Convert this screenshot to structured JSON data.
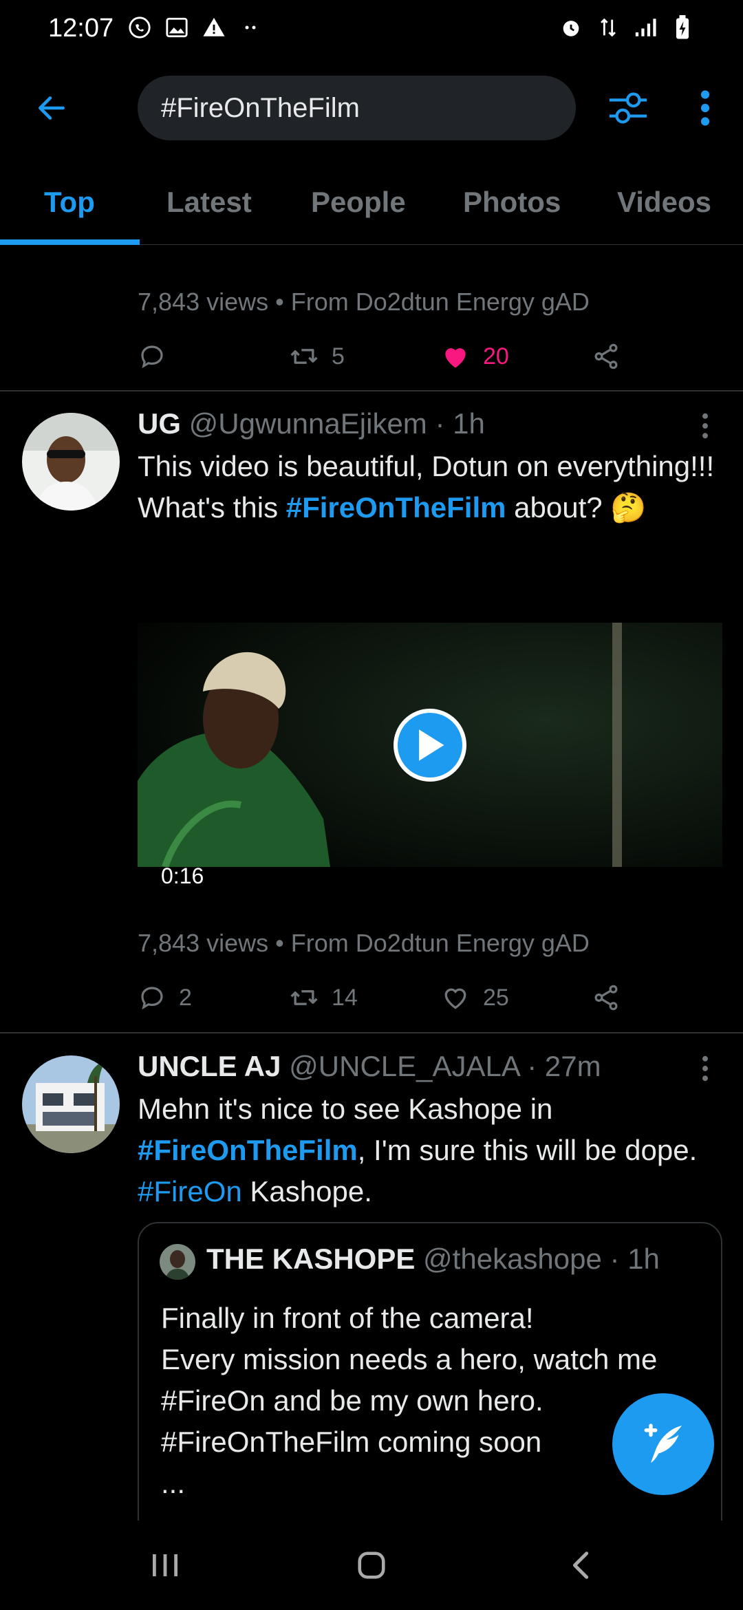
{
  "status_bar": {
    "time": "12:07"
  },
  "search": {
    "query": "#FireOnTheFilm"
  },
  "tabs": [
    {
      "label": "Top",
      "active": true
    },
    {
      "label": "Latest",
      "active": false
    },
    {
      "label": "People",
      "active": false
    },
    {
      "label": "Photos",
      "active": false
    },
    {
      "label": "Videos",
      "active": false
    }
  ],
  "prev_tweet": {
    "views_line": "7,843 views • From Do2dtun Energy gAD",
    "retweets": "5",
    "likes": "20"
  },
  "tweet1": {
    "name": "UG",
    "handle": "@UgwunnaEjikem",
    "time": "· 1h",
    "text_1": "This video is beautiful, Dotun on everything!!! What's this ",
    "hashtag": "#FireOnTheFilm",
    "text_2": " about? 🤔",
    "video_duration": "0:16",
    "views_line": "7,843 views • From Do2dtun Energy gAD",
    "replies": "2",
    "retweets": "14",
    "likes": "25"
  },
  "tweet2": {
    "name": "UNCLE AJ",
    "handle": "@UNCLE_AJALA",
    "time": "· 27m",
    "text_1": "Mehn it's nice to see Kashope in ",
    "hashtag_1": "#FireOnTheFilm",
    "text_2": ", I'm sure this will be dope. ",
    "hashtag_2": "#FireOn",
    "text_3": " Kashope.",
    "quote": {
      "name": "THE KASHOPE",
      "handle": "@thekashope",
      "time": "· 1h",
      "line_1": "Finally in front of the camera!",
      "line_2": "Every mission needs a hero, watch me",
      "line_3": "#FireOn and be my own hero.",
      "line_4": "#FireOnTheFilm coming soon",
      "line_5": "..."
    }
  },
  "colors": {
    "accent": "#1d9bf0",
    "like": "#f91880",
    "muted": "#71767b",
    "background": "#000000"
  }
}
